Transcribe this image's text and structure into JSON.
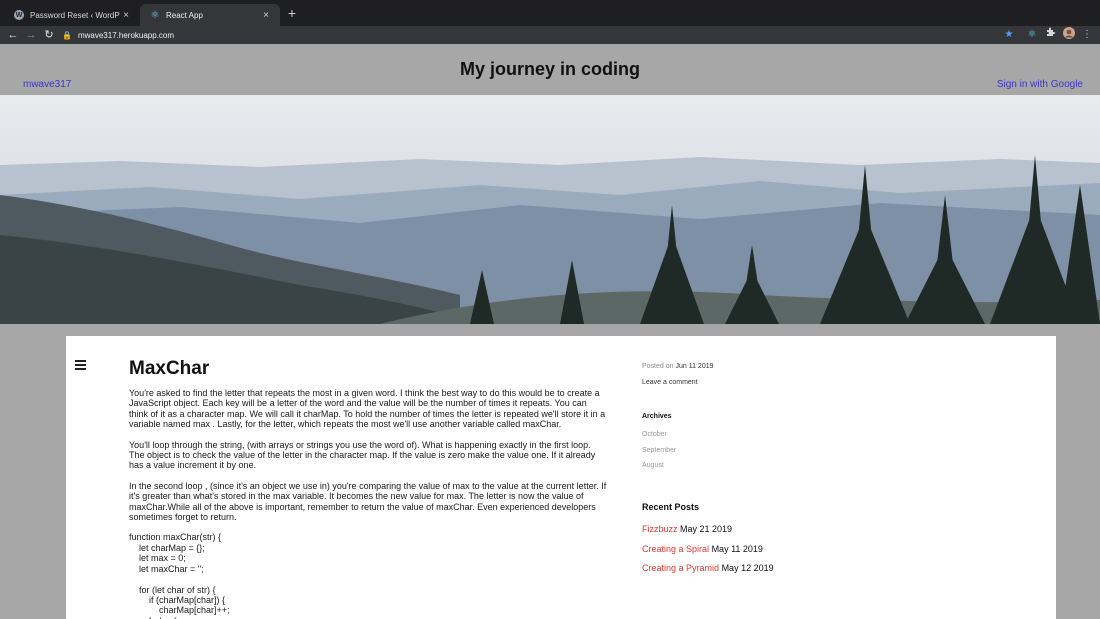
{
  "browser": {
    "tabs": [
      {
        "title": "Password Reset ‹ WordPress.c",
        "favicon": "wordpress-icon",
        "active": false
      },
      {
        "title": "React App",
        "favicon": "react-icon",
        "active": true
      }
    ],
    "new_tab_glyph": "+",
    "close_glyph": "×",
    "url": "mwave317.herokuapp.com",
    "nav": {
      "back": "←",
      "forward": "→",
      "reload": "↻"
    }
  },
  "header": {
    "title": "My journey in coding",
    "user_link": "mwave317",
    "signin_link": "Sign in with Google"
  },
  "post": {
    "title": "MaxChar",
    "paragraphs": [
      "You're asked to find the letter that repeats the most in a given word. I think the best way to do this would be to create a JavaScript object. Each key will be a letter of the word and the value will be the number of times it repeats. You can think of it as a character map. We will call it charMap. To hold the number of times the letter is repeated we'll store it in a variable named max . Lastly, for the letter, which repeats the most we'll use another variable called maxChar.",
      "You'll loop through the string, (with arrays or strings you use the word of). What  is happening exactly in the first loop. The object is to check the value of the letter in the character map. If the value is zero make the value one. If it already has a value increment it by one.",
      " In the second loop , (since it's an object we use in) you're comparing the value of max to the value at the current letter. If it's greater than what's stored in the max variable. It becomes the new value for max. The letter is now the value of maxChar.While all of the above is important, remember to return the value of maxChar. Even experienced developers sometimes forget to return."
    ],
    "code": "function maxChar(str) {\n    let charMap = {};\n    let max = 0;\n    let maxChar = '';\n\n    for (let char of str) {\n        if (charMap[char]) {\n            charMap[char]++;\n        } else {"
  },
  "sidebar": {
    "posted_on_label": "Posted on",
    "posted_on_date": "Jun 11 2019",
    "leave_comment": "Leave a comment",
    "archives_title": "Archives",
    "archives": [
      "October",
      "September",
      "August"
    ],
    "recent_title": "Recent Posts",
    "recent_posts": [
      {
        "title": "Fizzbuzz",
        "date": "May 21 2019"
      },
      {
        "title": "Creating a Spiral",
        "date": "May 11 2019"
      },
      {
        "title": "Creating a Pyramid",
        "date": "May 12 2019"
      }
    ]
  },
  "colors": {
    "page_bg": "#a7a7a7",
    "link_blue": "#3c35c8",
    "recent_link_red": "#e5392f"
  }
}
